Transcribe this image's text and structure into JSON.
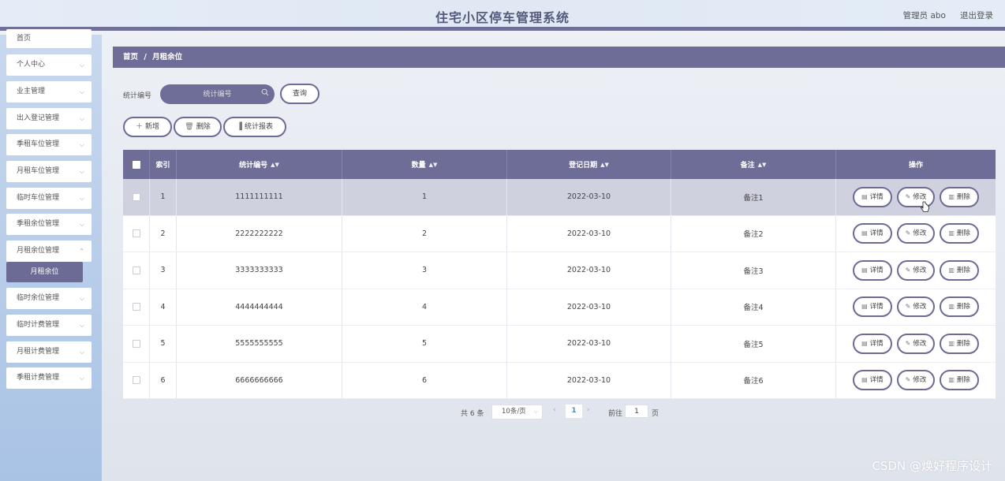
{
  "header": {
    "title": "住宅小区停车管理系统",
    "admin": "管理员 abo",
    "logout": "退出登录"
  },
  "sidebar": {
    "items": [
      {
        "label": "首页",
        "chevron": false
      },
      {
        "label": "个人中心",
        "chevron": true
      },
      {
        "label": "业主管理",
        "chevron": true
      },
      {
        "label": "出入登记管理",
        "chevron": true
      },
      {
        "label": "季租车位管理",
        "chevron": true
      },
      {
        "label": "月租车位管理",
        "chevron": true
      },
      {
        "label": "临时车位管理",
        "chevron": true
      },
      {
        "label": "季租余位管理",
        "chevron": true
      },
      {
        "label": "月租余位管理",
        "chevron": true
      },
      {
        "label": "临时余位管理",
        "chevron": true
      },
      {
        "label": "临时计费管理",
        "chevron": true
      },
      {
        "label": "月租计费管理",
        "chevron": true
      },
      {
        "label": "季租计费管理",
        "chevron": true
      }
    ],
    "active_sub": "月租余位"
  },
  "breadcrumb": {
    "home": "首页",
    "sep": "/",
    "current": "月租余位"
  },
  "search": {
    "label": "统计编号",
    "placeholder": "统计编号",
    "query_button": "查询"
  },
  "toolbar": {
    "add": "新增",
    "delete": "删除",
    "report": "统计报表"
  },
  "table": {
    "columns": [
      "索引",
      "统计编号",
      "数量",
      "登记日期",
      "备注",
      "操作"
    ],
    "rows": [
      {
        "index": "1",
        "code": "1111111111",
        "qty": "1",
        "date": "2022-03-10",
        "note": "备注1"
      },
      {
        "index": "2",
        "code": "2222222222",
        "qty": "2",
        "date": "2022-03-10",
        "note": "备注2"
      },
      {
        "index": "3",
        "code": "3333333333",
        "qty": "3",
        "date": "2022-03-10",
        "note": "备注3"
      },
      {
        "index": "4",
        "code": "4444444444",
        "qty": "4",
        "date": "2022-03-10",
        "note": "备注4"
      },
      {
        "index": "5",
        "code": "5555555555",
        "qty": "5",
        "date": "2022-03-10",
        "note": "备注5"
      },
      {
        "index": "6",
        "code": "6666666666",
        "qty": "6",
        "date": "2022-03-10",
        "note": "备注6"
      }
    ],
    "actions": {
      "detail": "详情",
      "edit": "修改",
      "delete": "删除"
    }
  },
  "pagination": {
    "total": "共 6 条",
    "page_size": "10条/页",
    "current_page": "1",
    "goto_label": "前往",
    "goto_value": "1",
    "unit": "页"
  },
  "watermark": "CSDN @焕好程序设计",
  "colors": {
    "accent": "#6d6d97",
    "header_bg": "#e4edf7",
    "sidebar_bg": "#b7cdea"
  }
}
